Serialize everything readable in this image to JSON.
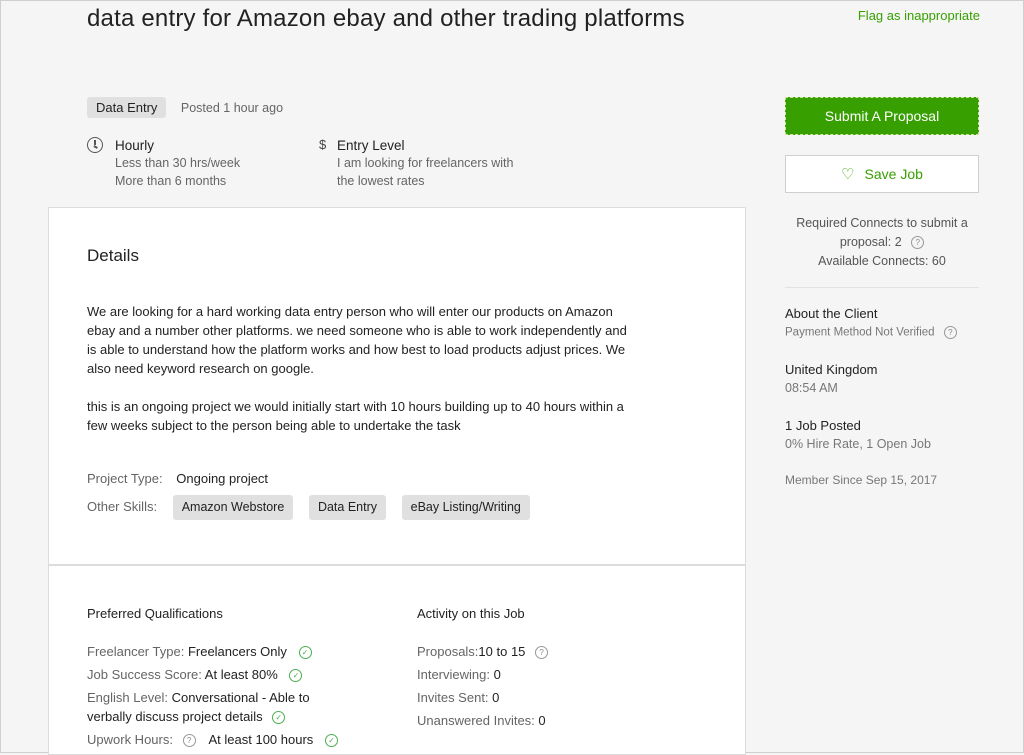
{
  "job": {
    "title": "data entry for Amazon ebay and other trading platforms",
    "flag_label": "Flag as inappropriate",
    "category": "Data Entry",
    "posted": "Posted 1 hour ago",
    "hourly": {
      "title": "Hourly",
      "line1": "Less than 30 hrs/week",
      "line2": "More than 6 months"
    },
    "level": {
      "symbol": "$",
      "title": "Entry Level",
      "line1": "I am looking for freelancers with",
      "line2": "the lowest rates"
    }
  },
  "details": {
    "heading": "Details",
    "para1_l1": "We are looking for a hard working data entry person who will enter our products on Amazon",
    "para1_l2": "ebay and a number other platforms.  we need someone who is able to work independently and",
    "para1_l3": "is able to understand how the platform works and how best to load products adjust prices. We",
    "para1_l4": "also need keyword research on google.",
    "para2_l1": "this is an ongoing project we would initially start with 10 hours building up to 40 hours within a",
    "para2_l2": "few weeks subject to the person being able to undertake the task",
    "project_type_label": "Project Type:",
    "project_type_value": "Ongoing project",
    "skills_label": "Other Skills:",
    "skills": [
      "Amazon Webstore",
      "Data Entry",
      "eBay Listing/Writing"
    ]
  },
  "qualifications": {
    "heading": "Preferred Qualifications",
    "freelancer_type_label": "Freelancer Type:",
    "freelancer_type_value": "Freelancers Only",
    "jss_label": "Job Success Score:",
    "jss_value": "At least 80%",
    "english_label": "English Level:",
    "english_value_l1": "Conversational - Able to",
    "english_value_l2": "verbally discuss project details",
    "hours_label": "Upwork Hours:",
    "hours_value": "At least 100 hours"
  },
  "activity": {
    "heading": "Activity on this Job",
    "proposals_label": "Proposals:",
    "proposals_value": "10 to 15",
    "interviewing_label": "Interviewing:",
    "interviewing_value": "0",
    "invites_label": "Invites Sent:",
    "invites_value": "0",
    "unanswered_label": "Unanswered Invites:",
    "unanswered_value": "0"
  },
  "sidebar": {
    "submit_label": "Submit A Proposal",
    "save_label": "Save Job",
    "connects_l1": "Required Connects to submit a",
    "connects_l2": "proposal: 2",
    "connects_l3": "Available Connects: 60",
    "about_title": "About the Client",
    "payment": "Payment Method Not Verified",
    "country": "United Kingdom",
    "time": "08:54 AM",
    "jobs_posted": "1 Job Posted",
    "hire_rate": "0% Hire Rate, 1 Open Job",
    "member_since": "Member Since Sep 15, 2017"
  },
  "colors": {
    "accent": "#37a000",
    "tag_bg": "#e0e0e0"
  },
  "icons": {
    "clock": "clock-icon",
    "dollar": "dollar-icon",
    "heart": "heart-icon",
    "question": "question-icon",
    "check": "check-circle-icon"
  }
}
